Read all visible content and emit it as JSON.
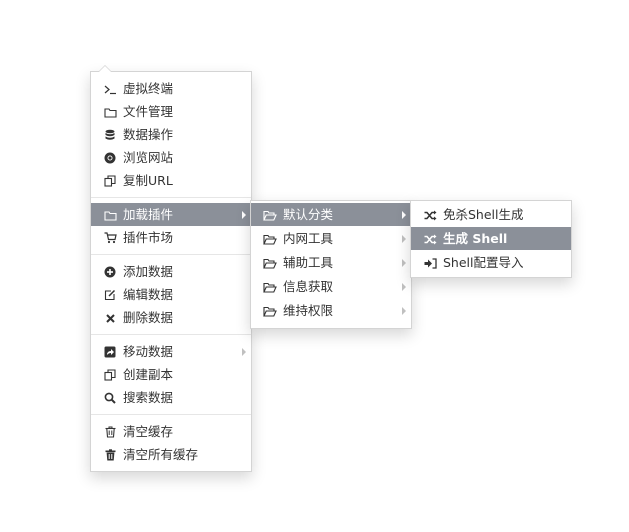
{
  "main_menu": {
    "items": [
      {
        "label": "虚拟终端",
        "icon": "terminal-icon"
      },
      {
        "label": "文件管理",
        "icon": "folder-icon"
      },
      {
        "label": "数据操作",
        "icon": "database-icon"
      },
      {
        "label": "浏览网站",
        "icon": "chrome-icon"
      },
      {
        "label": "复制URL",
        "icon": "copy-icon"
      },
      {
        "label": "加载插件",
        "icon": "folder-icon",
        "active": true,
        "submenu": true
      },
      {
        "label": "插件市场",
        "icon": "cart-icon"
      },
      {
        "label": "添加数据",
        "icon": "plus-circle-icon"
      },
      {
        "label": "编辑数据",
        "icon": "edit-icon"
      },
      {
        "label": "删除数据",
        "icon": "times-icon"
      },
      {
        "label": "移动数据",
        "icon": "share-square-icon",
        "submenu": true
      },
      {
        "label": "创建副本",
        "icon": "copy-icon"
      },
      {
        "label": "搜索数据",
        "icon": "search-icon"
      },
      {
        "label": "清空缓存",
        "icon": "trash-outline-icon"
      },
      {
        "label": "清空所有缓存",
        "icon": "trash-icon"
      }
    ]
  },
  "plugin_menu": {
    "items": [
      {
        "label": "默认分类",
        "icon": "folder-open-icon",
        "active": true,
        "submenu": true
      },
      {
        "label": "内网工具",
        "icon": "folder-open-icon",
        "submenu": true
      },
      {
        "label": "辅助工具",
        "icon": "folder-open-icon",
        "submenu": true
      },
      {
        "label": "信息获取",
        "icon": "folder-open-icon",
        "submenu": true
      },
      {
        "label": "维持权限",
        "icon": "folder-open-icon",
        "submenu": true
      }
    ]
  },
  "default_category_menu": {
    "items": [
      {
        "label": "免杀Shell生成",
        "icon": "shuffle-icon"
      },
      {
        "label": "生成 Shell",
        "icon": "shuffle-icon",
        "active": true
      },
      {
        "label": "Shell配置导入",
        "icon": "sign-in-icon"
      }
    ]
  },
  "colors": {
    "active_bg": "#8b9099",
    "border": "#d4d4d4",
    "text": "#333333"
  }
}
